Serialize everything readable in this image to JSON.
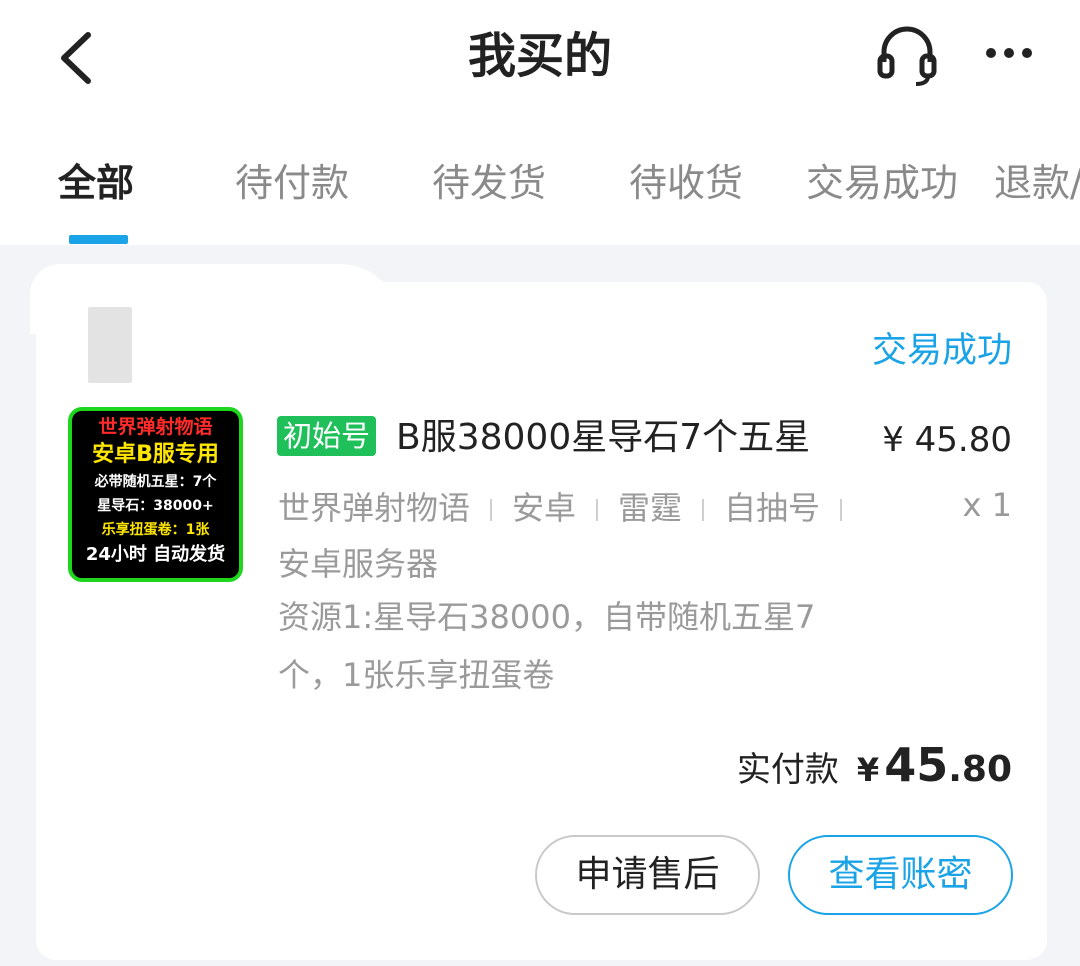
{
  "header": {
    "title": "我买的",
    "icons": {
      "back": "chevron-left-icon",
      "service": "headset-icon",
      "more": "more-dots-icon"
    }
  },
  "tabs": [
    {
      "label": "全部",
      "active": true
    },
    {
      "label": "待付款",
      "active": false
    },
    {
      "label": "待发货",
      "active": false
    },
    {
      "label": "待收货",
      "active": false
    },
    {
      "label": "交易成功",
      "active": false
    },
    {
      "label": "退款/",
      "active": false
    }
  ],
  "order": {
    "status": "交易成功",
    "thumbnail": {
      "line1": "世界弹射物语",
      "line2": "安卓B服专用",
      "line3": "必带随机五星：7个",
      "line4": "星导石：38000+",
      "line5": "乐享扭蛋卷：1张",
      "line6": "24小时 自动发货"
    },
    "badge": "初始号",
    "title": "B服38000星导石7个五星",
    "price": "¥ 45.80",
    "quantity": "x 1",
    "specs": [
      "世界弹射物语",
      "安卓",
      "雷霆",
      "自抽号"
    ],
    "specs_line2": "安卓服务器",
    "resource_line1": "资源1:星导石38000，自带随机五星7",
    "resource_line2": "个，1张乐享扭蛋卷",
    "paid_label": "实付款",
    "paid_currency": "¥",
    "paid_integer": "45",
    "paid_decimal": ".80",
    "buttons": {
      "after_sale": "申请售后",
      "view_account": "查看账密"
    }
  },
  "colors": {
    "accent": "#1aa3e6",
    "badge": "#1fbf5a",
    "background": "#f2f4f7"
  }
}
